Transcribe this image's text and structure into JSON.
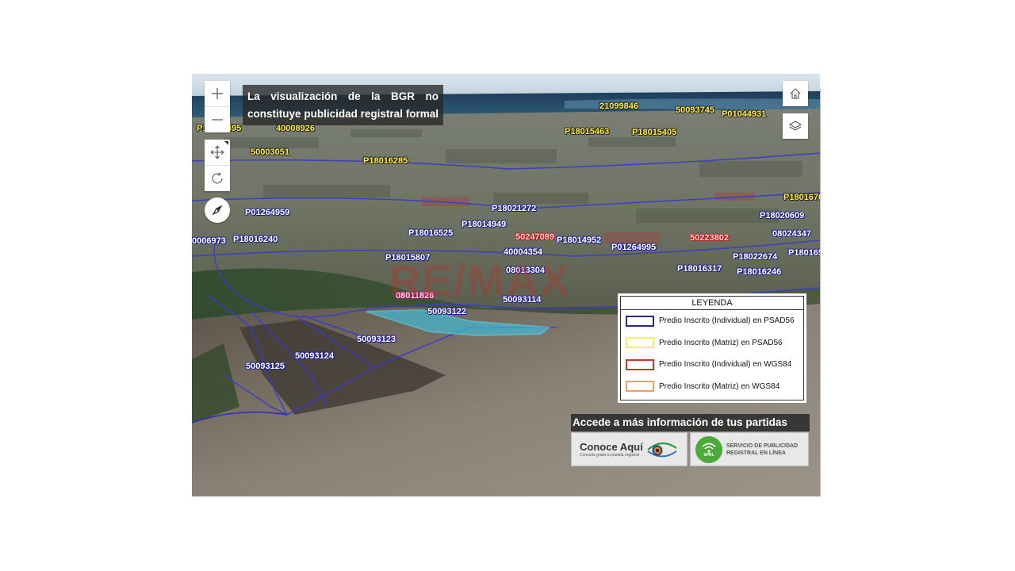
{
  "controls": {
    "zoom_in_icon": "plus-icon",
    "zoom_out_icon": "minus-icon",
    "pan_icon": "move-icon",
    "rotate_icon": "rotate-icon",
    "compass_icon": "compass-icon",
    "home_icon": "home-icon",
    "layers_icon": "layers-icon"
  },
  "disclaimer": "La visualización de la BGR no constituye publicidad registral formal",
  "watermark": "RE/MAX",
  "parcel_labels": [
    {
      "text": "P18015495",
      "color": "yellow"
    },
    {
      "text": "40008926",
      "color": "yellow"
    },
    {
      "text": "50003051",
      "color": "yellow"
    },
    {
      "text": "P18016285",
      "color": "yellow"
    },
    {
      "text": "21099846",
      "color": "yellow"
    },
    {
      "text": "50093745",
      "color": "yellow"
    },
    {
      "text": "P01044931",
      "color": "yellow"
    },
    {
      "text": "P18015463",
      "color": "yellow"
    },
    {
      "text": "P18015405",
      "color": "yellow"
    },
    {
      "text": "P1801670",
      "color": "yellow"
    },
    {
      "text": "P18021272",
      "color": "blue"
    },
    {
      "text": "P18020609",
      "color": "blue"
    },
    {
      "text": "P01264959",
      "color": "blue"
    },
    {
      "text": "P18014949",
      "color": "blue"
    },
    {
      "text": "08024347",
      "color": "blue"
    },
    {
      "text": "0006973",
      "color": "blue"
    },
    {
      "text": "P18016240",
      "color": "blue"
    },
    {
      "text": "P18016525",
      "color": "blue"
    },
    {
      "text": "50247089",
      "color": "red"
    },
    {
      "text": "P18014952",
      "color": "blue"
    },
    {
      "text": "50223802",
      "color": "red"
    },
    {
      "text": "P01264995",
      "color": "blue"
    },
    {
      "text": "40004354",
      "color": "blue"
    },
    {
      "text": "P18015807",
      "color": "blue"
    },
    {
      "text": "P18022674",
      "color": "blue"
    },
    {
      "text": "P180165",
      "color": "blue"
    },
    {
      "text": "08013304",
      "color": "blue"
    },
    {
      "text": "P18016317",
      "color": "blue"
    },
    {
      "text": "P18016246",
      "color": "blue"
    },
    {
      "text": "08011826",
      "color": "magenta"
    },
    {
      "text": "50093114",
      "color": "blue"
    },
    {
      "text": "50093122",
      "color": "blue"
    },
    {
      "text": "50093123",
      "color": "blue"
    },
    {
      "text": "50093124",
      "color": "blue"
    },
    {
      "text": "50093125",
      "color": "blue"
    }
  ],
  "legend": {
    "title": "LEYENDA",
    "items": [
      {
        "label": "Predio Inscrito (Individual) en PSAD56",
        "color": "#2a2a8c"
      },
      {
        "label": "Predio Inscrito (Matriz) en PSAD56",
        "color": "#f4f060"
      },
      {
        "label": "Predio Inscrito (Individual) en WGS84",
        "color": "#d23030"
      },
      {
        "label": "Predio Inscrito (Matriz) en WGS84",
        "color": "#e8a070"
      }
    ]
  },
  "promo": {
    "title": "Accede a más información de tus partidas",
    "conoce_main": "Conoce Aquí",
    "conoce_sub": "Consulta gratis tu partida registral",
    "spr_icon_text": "SPRL",
    "spr_line1": "SERVICIO DE PUBLICIDAD",
    "spr_line2": "REGISTRAL EN LÍNEA"
  }
}
